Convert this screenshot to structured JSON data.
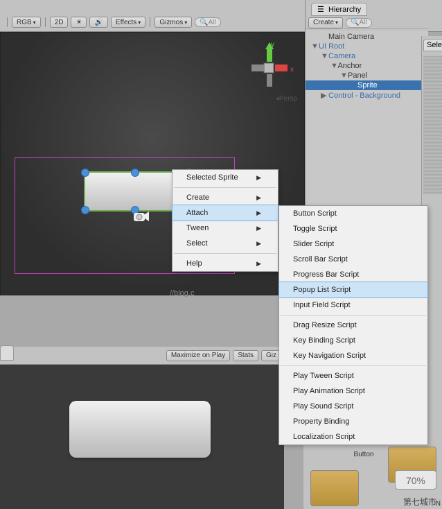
{
  "toolbar": {
    "rgb": "RGB",
    "twod": "2D",
    "effects": "Effects",
    "gizmos": "Gizmos",
    "search_ph": "All"
  },
  "scene": {
    "persp": "Persp",
    "axis_x": "x",
    "axis_y": "y",
    "watermark": "//blog.c"
  },
  "game": {
    "maximize": "Maximize on Play",
    "stats": "Stats",
    "gizmos": "Giz"
  },
  "hierarchy": {
    "title": "Hierarchy",
    "create": "Create",
    "search_ph": "All",
    "items": [
      {
        "label": "Main Camera",
        "indent": 1,
        "link": false,
        "expand": ""
      },
      {
        "label": "UI Root",
        "indent": 0,
        "link": true,
        "expand": "▼"
      },
      {
        "label": "Camera",
        "indent": 1,
        "link": true,
        "expand": "▼"
      },
      {
        "label": "Anchor",
        "indent": 2,
        "link": false,
        "expand": "▼"
      },
      {
        "label": "Panel",
        "indent": 3,
        "link": false,
        "expand": "▼"
      },
      {
        "label": "Sprite",
        "indent": 4,
        "link": false,
        "expand": "",
        "sel": true
      },
      {
        "label": "Control - Background",
        "indent": 1,
        "link": true,
        "expand": "▶"
      }
    ]
  },
  "selector": {
    "label": "Selec"
  },
  "context": {
    "main": [
      {
        "label": "Selected Sprite",
        "arrow": true
      },
      {
        "sep": true
      },
      {
        "label": "Create",
        "arrow": true
      },
      {
        "label": "Attach",
        "arrow": true,
        "hl": true
      },
      {
        "label": "Tween",
        "arrow": true
      },
      {
        "label": "Select",
        "arrow": true
      },
      {
        "sep": true
      },
      {
        "label": "Help",
        "arrow": true
      }
    ],
    "sub": [
      {
        "label": "Button Script"
      },
      {
        "label": "Toggle Script"
      },
      {
        "label": "Slider Script"
      },
      {
        "label": "Scroll Bar Script"
      },
      {
        "label": "Progress Bar Script"
      },
      {
        "label": "Popup List Script",
        "hl": true
      },
      {
        "label": "Input Field Script"
      },
      {
        "sep": true
      },
      {
        "label": "Drag Resize Script"
      },
      {
        "label": "Key Binding Script"
      },
      {
        "label": "Key Navigation Script"
      },
      {
        "sep": true
      },
      {
        "label": "Play Tween Script"
      },
      {
        "label": "Play Animation Script"
      },
      {
        "label": "Play Sound Script"
      },
      {
        "label": "Property Binding"
      },
      {
        "label": "Localization Script"
      }
    ]
  },
  "rb": {
    "button_label": "Button",
    "pct": "70%"
  },
  "wm": {
    "text": "第七城市",
    "n": "N"
  }
}
